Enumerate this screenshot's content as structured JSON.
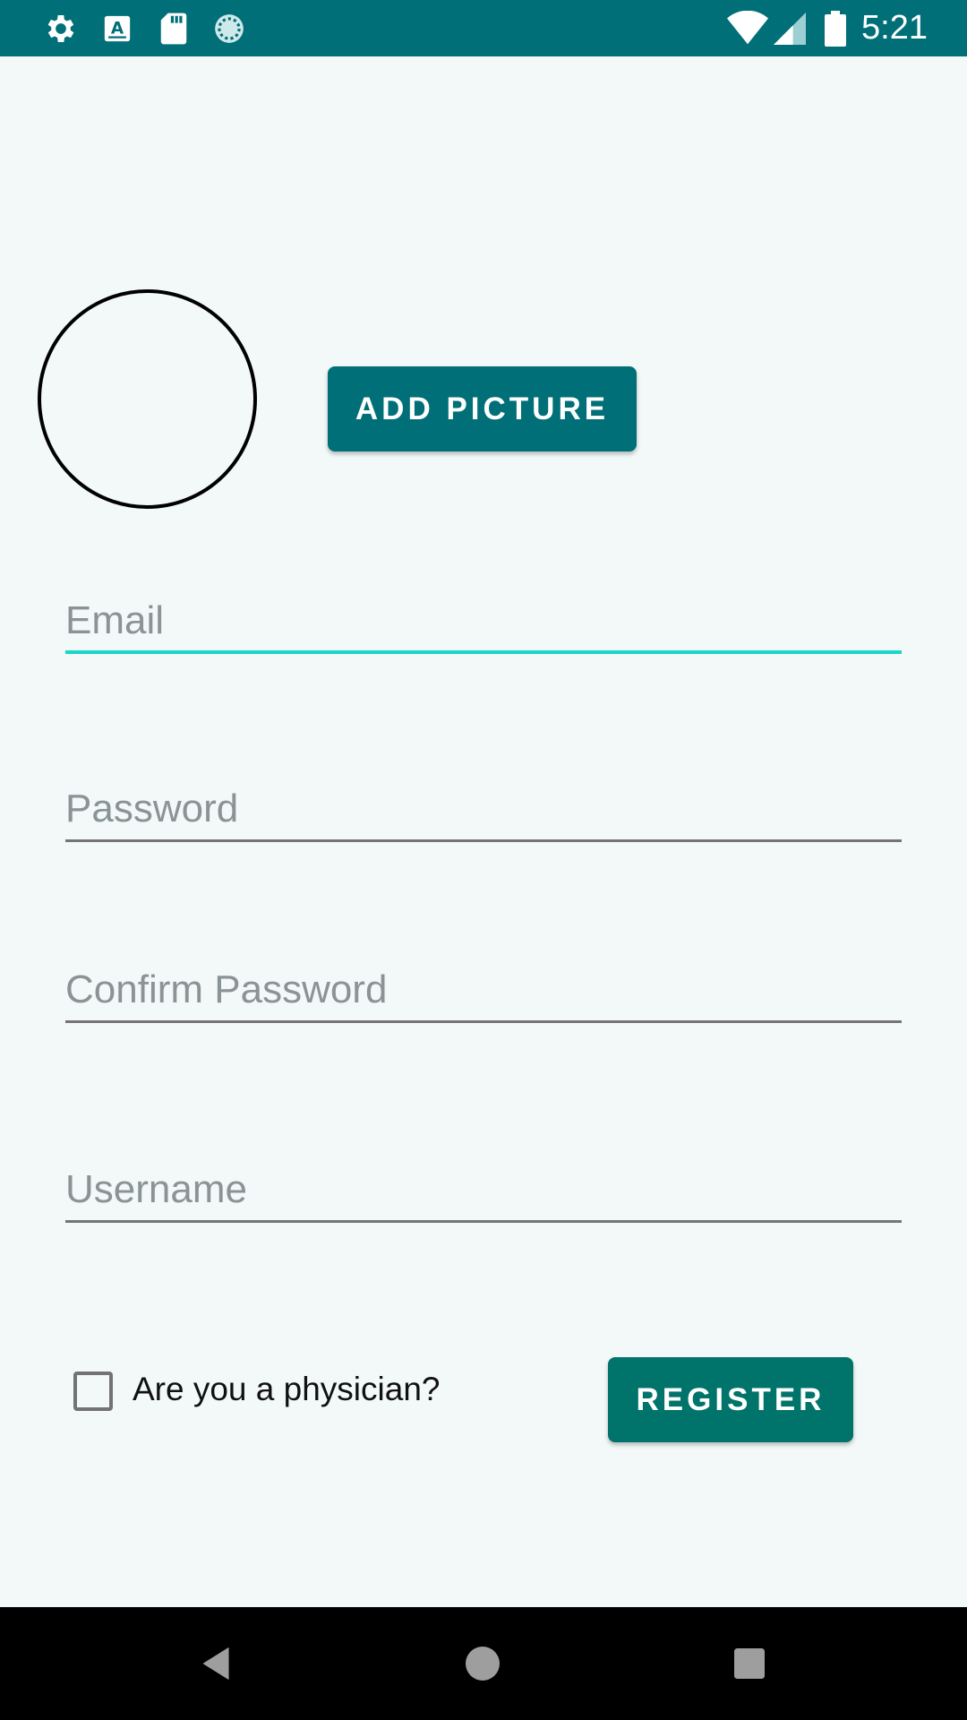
{
  "status_bar": {
    "time": "5:21",
    "icons": [
      "settings-icon",
      "text-a-icon",
      "sd-card-icon",
      "sync-icon",
      "wifi-icon",
      "signal-icon",
      "battery-icon"
    ],
    "background": "#006f78"
  },
  "profile": {
    "add_picture_label": "ADD PICTURE"
  },
  "form": {
    "email_placeholder": "Email",
    "password_placeholder": "Password",
    "confirm_password_placeholder": "Confirm Password",
    "username_placeholder": "Username",
    "physician_label": "Are you a physician?",
    "physician_checked": false,
    "register_label": "REGISTER"
  },
  "colors": {
    "primary": "#006f78",
    "register": "#00736a",
    "focus_accent": "#19d8c8",
    "background": "#f2f9f8"
  },
  "nav_bar": {
    "icons": [
      "back-icon",
      "home-icon",
      "recents-icon"
    ]
  }
}
